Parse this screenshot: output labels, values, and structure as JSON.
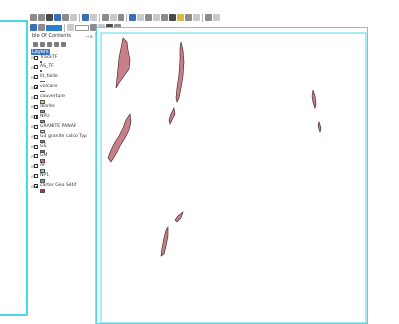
{
  "toc": {
    "title": "ble Of Contents",
    "pin": "⊣",
    "close": "×",
    "root_label": "Layers",
    "layers": [
      {
        "name": "TrackTF",
        "checked": false,
        "symbol": "dot",
        "color": "#222222"
      },
      {
        "name": "AS_TF",
        "checked": false,
        "symbol": "dot",
        "color": "#222222"
      },
      {
        "name": "lit_faille",
        "checked": false,
        "symbol": "line",
        "color": "#b23a6a"
      },
      {
        "name": "volcans",
        "checked": true,
        "symbol": "line",
        "color": "#c23060"
      },
      {
        "name": "couverture",
        "checked": false,
        "symbol": "sq",
        "color": "#e8e430"
      },
      {
        "name": "diorite",
        "checked": false,
        "symbol": "sq",
        "color": "#6aa0e0"
      },
      {
        "name": "NPU",
        "checked": true,
        "symbol": "sq",
        "color": "#c77f8a"
      },
      {
        "name": "GRANITE PANAF",
        "checked": false,
        "symbol": "sq",
        "color": "#d6d6d6"
      },
      {
        "name": "G3 granite calco Typ",
        "checked": false,
        "symbol": "sq",
        "color": "#a07a5a"
      },
      {
        "name": "GS",
        "checked": false,
        "symbol": "sq",
        "color": "#6a7a4a"
      },
      {
        "name": "GM",
        "checked": false,
        "symbol": "sq",
        "color": "#e45aa8"
      },
      {
        "name": "AF",
        "checked": false,
        "symbol": "sq",
        "color": "#58e0e0"
      },
      {
        "name": "NP1",
        "checked": false,
        "symbol": "sq",
        "color": "#58c058"
      },
      {
        "name": "carter Geo Sétif",
        "checked": true,
        "symbol": "sq",
        "color": "#e02020"
      }
    ]
  },
  "colors": {
    "frame": "#4fd8e8",
    "polygon_fill": "#c77f8a",
    "polygon_stroke": "#3a1a1e"
  }
}
